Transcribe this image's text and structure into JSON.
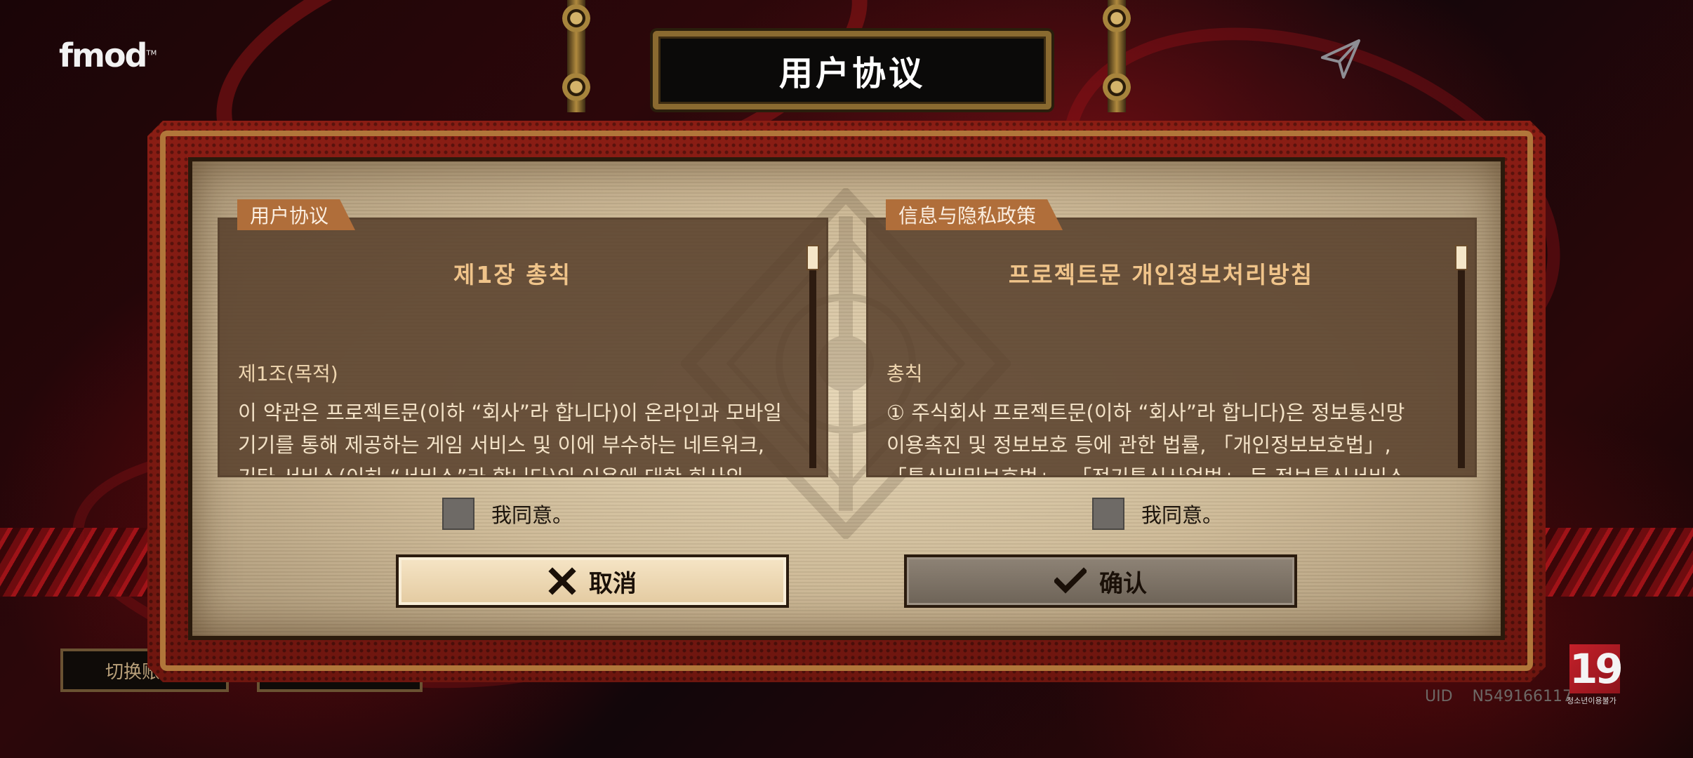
{
  "brand": {
    "logo_text": "fmod",
    "logo_mark": "TM"
  },
  "header": {
    "title": "用户协议"
  },
  "panels": {
    "user_agreement": {
      "tab_label": "用户协议",
      "title": "제1장 총칙",
      "heading": "제1조(목적)",
      "body_lines": [
        "이 약관은 프로젝트문(이하 “회사”라 합니다)이 온라인과 모바일",
        "기기를 통해 제공하는 게임 서비스 및 이에 부수하는 네트워크,",
        "기타 서비스(이하 “서비스”라 합니다)의 이용에 대한 회사와"
      ],
      "agree_label": "我同意。"
    },
    "privacy_policy": {
      "tab_label": "信息与隐私政策",
      "title": "프로젝트문 개인정보처리방침",
      "heading": "총칙",
      "body_lines": [
        "① 주식회사 프로젝트문(이하 “회사”라 합니다)은 정보통신망",
        "이용촉진 및 정보보호 등에 관한 법률, 「개인정보보호법」,",
        "「통신비밀보호법」, 「전기통신사업법」 등 정보통신서비스"
      ],
      "agree_label": "我同意。"
    }
  },
  "buttons": {
    "cancel": "取消",
    "confirm": "确认"
  },
  "background_ui": {
    "switch_account": "切换账"
  },
  "footer": {
    "uid_label": "UID",
    "uid_value": "N549166117",
    "age_rating": "19",
    "age_caption": "청소년이용불가"
  },
  "icons": {
    "share": "send-icon",
    "cancel": "x-icon",
    "confirm": "check-icon",
    "checkbox": "checkbox-unchecked"
  },
  "colors": {
    "accent": "#b06e3a",
    "panel": "#563e2a",
    "title_text": "#f0c48a",
    "frame_red": "#8a1d14"
  }
}
